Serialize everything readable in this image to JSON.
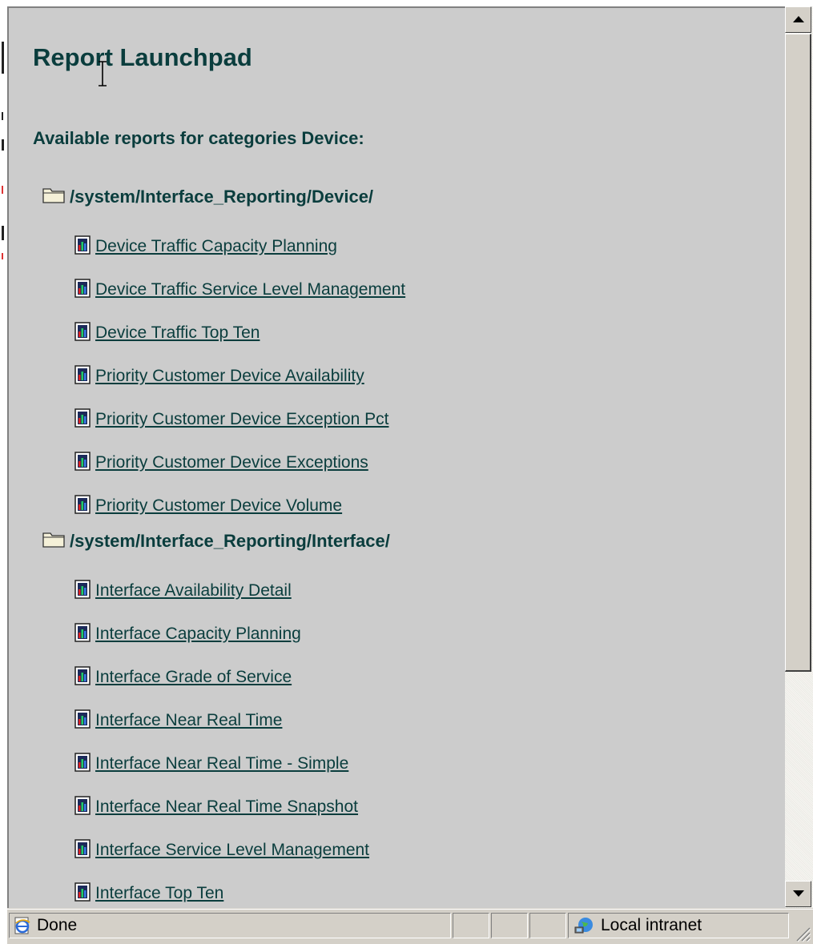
{
  "page": {
    "title": "Report Launchpad",
    "subtitle": "Available reports for categories Device:"
  },
  "folders": [
    {
      "path": "/system/Interface_Reporting/Device/",
      "reports": [
        " Device Traffic Capacity Planning",
        " Device Traffic Service Level Management",
        " Device Traffic Top Ten",
        " Priority Customer Device Availability",
        " Priority Customer Device Exception Pct",
        " Priority Customer Device Exceptions",
        " Priority Customer Device Volume"
      ]
    },
    {
      "path": "/system/Interface_Reporting/Interface/",
      "reports": [
        " Interface Availability Detail",
        " Interface Capacity Planning",
        " Interface Grade of Service",
        " Interface Near Real Time",
        " Interface Near Real Time - Simple",
        " Interface Near Real Time Snapshot",
        " Interface Service Level Management",
        " Interface Top Ten"
      ]
    }
  ],
  "status": {
    "text": "Done",
    "zone": "Local intranet"
  },
  "icons": {
    "folder": "folder-icon",
    "report": "report-chart-icon",
    "status": "ie-page-icon",
    "zone": "local-intranet-icon"
  },
  "colors": {
    "text": "#0a3d3d",
    "background": "#cccccc",
    "chrome": "#d4d0c8"
  }
}
